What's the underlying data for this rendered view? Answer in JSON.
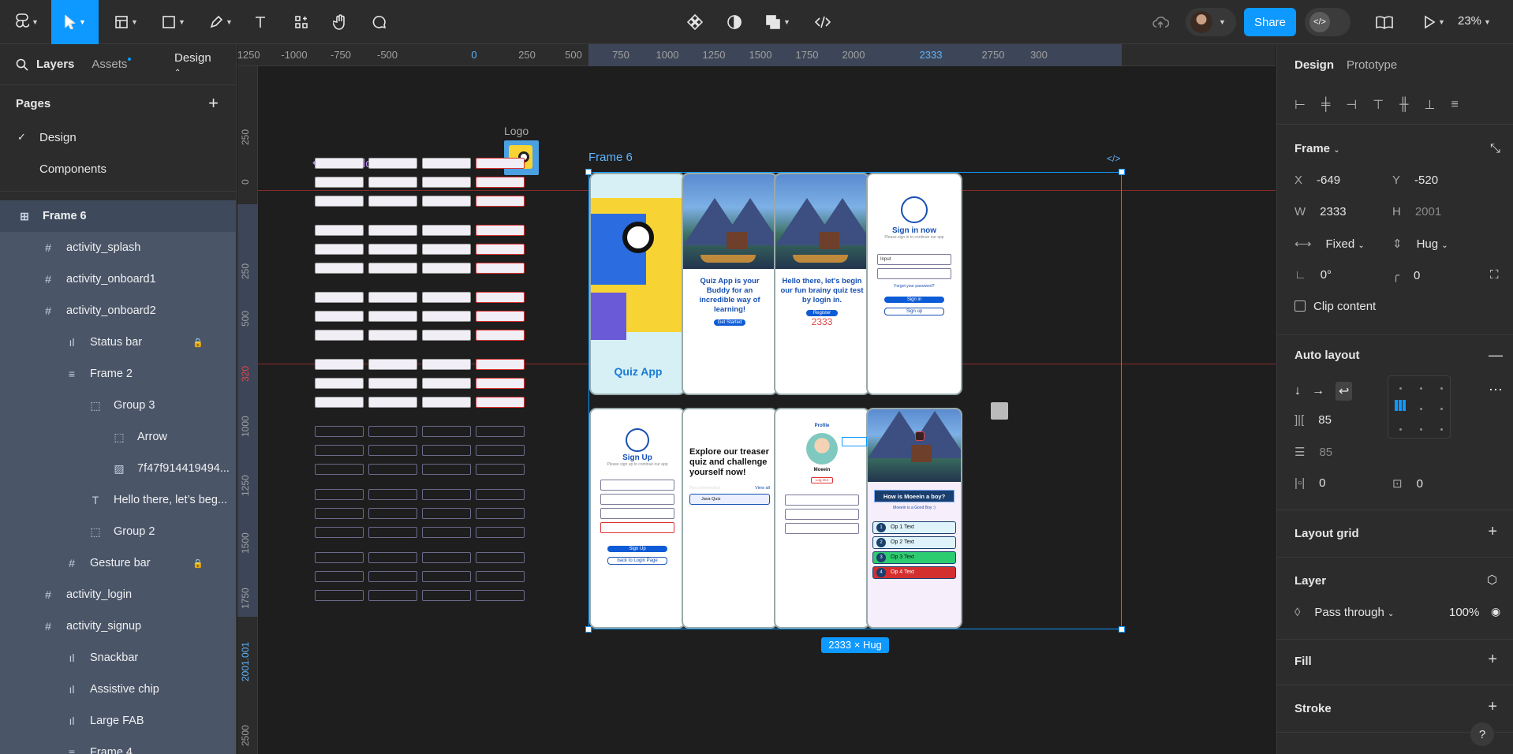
{
  "toolbar": {
    "tools": [
      "main-menu",
      "move",
      "frame",
      "shape",
      "pen",
      "text",
      "resources",
      "hand",
      "comment"
    ],
    "center_tools": [
      "component",
      "mask",
      "boolean",
      "dev-code"
    ],
    "share_label": "Share",
    "zoom": "23%"
  },
  "left_panel": {
    "tabs": {
      "layers": "Layers",
      "assets": "Assets",
      "page_switch": "Design"
    },
    "pages_title": "Pages",
    "pages": [
      {
        "label": "Design",
        "selected": true
      },
      {
        "label": "Components",
        "selected": false
      }
    ],
    "selected_layer": "Frame 6",
    "layers": [
      {
        "label": "activity_splash",
        "indent": 1,
        "icon": "#"
      },
      {
        "label": "activity_onboard1",
        "indent": 1,
        "icon": "#"
      },
      {
        "label": "activity_onboard2",
        "indent": 1,
        "icon": "#"
      },
      {
        "label": "Status bar",
        "indent": 2,
        "icon": "ıl",
        "locked": true
      },
      {
        "label": "Frame 2",
        "indent": 2,
        "icon": "≡"
      },
      {
        "label": "Group 3",
        "indent": 3,
        "icon": "⬚"
      },
      {
        "label": "Arrow",
        "indent": 4,
        "icon": "⬚"
      },
      {
        "label": "7f47f914419494...",
        "indent": 4,
        "icon": "▨"
      },
      {
        "label": "Hello there, let’s beg...",
        "indent": 3,
        "icon": "T"
      },
      {
        "label": "Group 2",
        "indent": 3,
        "icon": "⬚"
      },
      {
        "label": "Gesture bar",
        "indent": 2,
        "icon": "#",
        "locked": true
      },
      {
        "label": "activity_login",
        "indent": 1,
        "icon": "#"
      },
      {
        "label": "activity_signup",
        "indent": 1,
        "icon": "#"
      },
      {
        "label": "Snackbar",
        "indent": 2,
        "icon": "ıl"
      },
      {
        "label": "Assistive chip",
        "indent": 2,
        "icon": "ıl"
      },
      {
        "label": "Large FAB",
        "indent": 2,
        "icon": "ıl"
      },
      {
        "label": "Frame 4",
        "indent": 2,
        "icon": "≡"
      }
    ]
  },
  "canvas": {
    "ruler_top": [
      "-1250",
      "-1000",
      "-750",
      "-500",
      "0",
      "250",
      "500",
      "750",
      "1000",
      "1250",
      "1500",
      "1750",
      "2000",
      "2333",
      "2750",
      "300"
    ],
    "ruler_left": [
      "250",
      "0",
      "250",
      "500",
      "320",
      "1000",
      "1250",
      "1500",
      "1750",
      "2001.001",
      "2500"
    ],
    "logo_label": "Logo",
    "text_field_label": "Text field",
    "frame_label": "Frame 6",
    "size_tag": "2333 × Hug",
    "screens": {
      "splash_title": "Quiz App",
      "onboard1_text": "Quiz App is your Buddy for an incredible way of learning!",
      "onboard1_btn": "Get Started",
      "onboard2_text": "Hello there, let's begin our fun brainy quiz test by login in.",
      "onboard2_btn": "Register",
      "onboard2_num": "2333",
      "login_title": "Sign in now",
      "login_sub": "Please sign in to continue our app",
      "login_in1": "Input",
      "login_forgot": "Forgot your password?",
      "login_btn": "Sign in",
      "login_btn2": "Sign up",
      "signup_title": "Sign Up",
      "signup_sub": "Please sign up to continue our app",
      "signup_btn": "Sign Up",
      "signup_back": "back to Login Page",
      "home_title": "Explore our treaser quiz and challenge yourself now!",
      "home_rec": "Recommended",
      "home_view": "View all",
      "home_item": "Java Quiz",
      "profile_title": "Profile",
      "profile_name": "Moeein",
      "profile_logout": "Log Out",
      "quiz_question": "How is Moeein a boy?",
      "quiz_hint": "Moeein is a Good Boy :)",
      "quiz_options": [
        "Op 1 Text",
        "Op 2 Text",
        "Op 3 Text",
        "Op 4 Text"
      ]
    }
  },
  "right_panel": {
    "tabs": {
      "design": "Design",
      "prototype": "Prototype"
    },
    "frame_section": "Frame",
    "x": "-649",
    "y": "-520",
    "w": "2333",
    "h": "2001",
    "width_mode": "Fixed",
    "height_mode": "Hug",
    "rotation": "0°",
    "radius": "0",
    "clip_content": "Clip content",
    "auto_layout": "Auto layout",
    "gap": "85",
    "gap2": "85",
    "pad_h": "0",
    "pad_v": "0",
    "layout_grid": "Layout grid",
    "layer": "Layer",
    "blend": "Pass through",
    "opacity": "100%",
    "fill": "Fill",
    "stroke": "Stroke"
  },
  "colors": {
    "accent": "#0d99ff",
    "panel": "#2c2c2c",
    "canvas": "#1e1e1e",
    "selection": "#4a5568"
  }
}
